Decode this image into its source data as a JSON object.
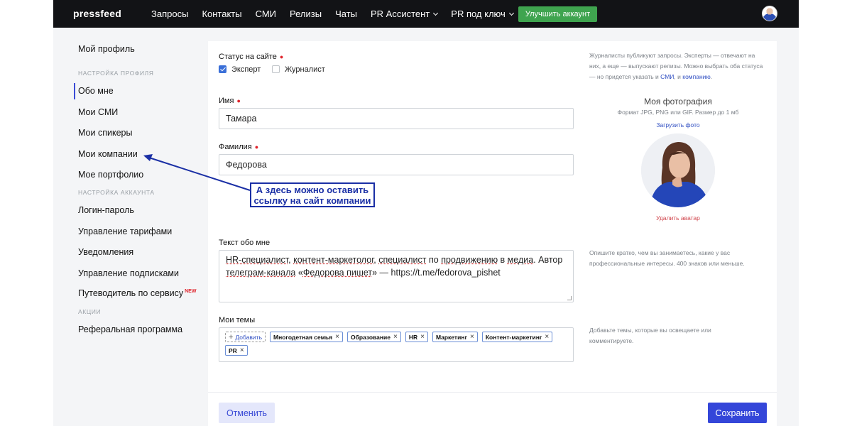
{
  "topbar": {
    "logo": "pressfeed",
    "nav": [
      {
        "label": "Запросы",
        "dropdown": false
      },
      {
        "label": "Контакты",
        "dropdown": false
      },
      {
        "label": "СМИ",
        "dropdown": false
      },
      {
        "label": "Релизы",
        "dropdown": false
      },
      {
        "label": "Чаты",
        "dropdown": false
      },
      {
        "label": "PR Ассистент",
        "dropdown": true
      },
      {
        "label": "PR под ключ",
        "dropdown": true
      }
    ],
    "upgrade_label": "Улучшить аккаунт"
  },
  "sidebar": {
    "profile": "Мой профиль",
    "section_profile": "НАСТРОЙКА ПРОФИЛЯ",
    "about": "Обо мне",
    "media": "Мои СМИ",
    "speakers": "Мои спикеры",
    "companies": "Мои компании",
    "portfolio": "Мое портфолио",
    "section_account": "НАСТРОЙКА АККАУНТА",
    "login": "Логин-пароль",
    "tariffs": "Управление тарифами",
    "notifications": "Уведомления",
    "subscriptions": "Управление подписками",
    "guide": "Путеводитель по сервису",
    "guide_badge": "NEW",
    "section_promo": "АКЦИИ",
    "referral": "Реферальная программа"
  },
  "form": {
    "status_label": "Статус на сайте",
    "expert_label": "Эксперт",
    "expert_checked": true,
    "journalist_label": "Журналист",
    "journalist_checked": false,
    "name_label": "Имя",
    "name_value": "Тамара",
    "surname_label": "Фамилия",
    "surname_value": "Федорова",
    "about_label": "Текст обо мне",
    "about_line1_parts": [
      "HR-специалист",
      ", ",
      "контент-маркетолог",
      ", ",
      "специалист",
      " по ",
      "продвижению",
      " в ",
      "медиа",
      ". Автор"
    ],
    "about_line2_parts": [
      "телеграм-канала",
      " «",
      "Федорова пишет",
      "» — https://t.me/fedorova_pishet"
    ],
    "topics_label": "Мои темы",
    "add_topic": "Добавить",
    "topics": [
      "Многодетная семья",
      "Образование",
      "HR",
      "Маркетинг",
      "Контент-маркетинг",
      "PR"
    ]
  },
  "hints": {
    "status_text": "Журналисты публикуют запросы. Эксперты — отвечают на них, а еще — выпускают релизы. Можно выбрать оба статуса — но придется указать и ",
    "status_link1": "СМИ",
    "status_and": ", и ",
    "status_link2": "компанию",
    "status_end": ".",
    "about_hint": "Опишите кратко, чем вы занимаетесь, какие у вас профессиональные интересы. 400 знаков или меньше.",
    "topics_hint": "Добавьте темы, которые вы освещаете или комментируете."
  },
  "photo": {
    "title": "Моя фотография",
    "formats": "Формат JPG, PNG или GIF. Размер до 1 мб",
    "upload": "Загрузить фото",
    "delete": "Удалить аватар"
  },
  "actions": {
    "cancel": "Отменить",
    "save": "Сохранить"
  },
  "annotation": {
    "line1": "А здесь можно оставить",
    "line2": "ссылку на сайт компании"
  },
  "colors": {
    "accent": "#3446d9",
    "topbar": "#121316",
    "upgrade": "#3fa44f",
    "annotation": "#1a2fa5",
    "required": "#e0242c"
  }
}
